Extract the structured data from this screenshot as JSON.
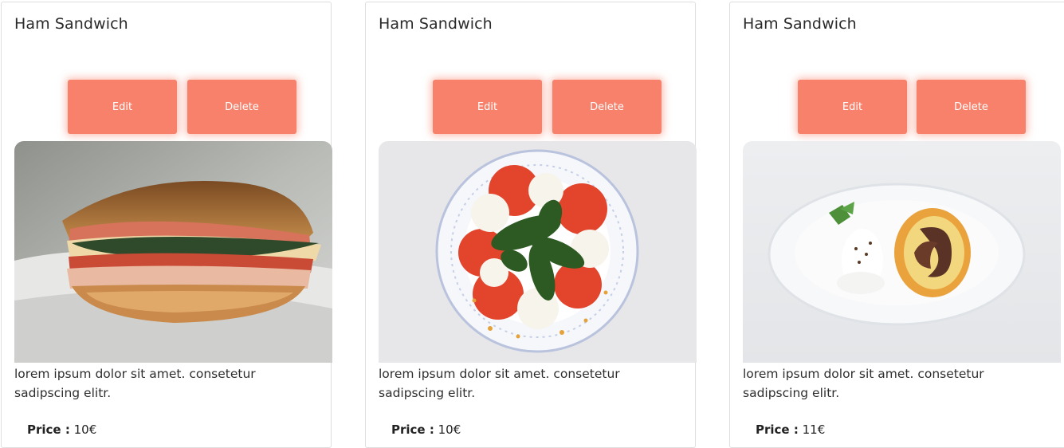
{
  "cards": [
    {
      "title": "Ham Sandwich",
      "edit_label": "Edit",
      "delete_label": "Delete",
      "image": "ham-sandwich",
      "description": "lorem ipsum dolor sit amet. consetetur sadipscing elitr.",
      "price_label": "Price :",
      "price_value": "10€"
    },
    {
      "title": "Ham Sandwich",
      "edit_label": "Edit",
      "delete_label": "Delete",
      "image": "caprese-salad",
      "description": "lorem ipsum dolor sit amet. consetetur sadipscing elitr.",
      "price_label": "Price :",
      "price_value": "10€"
    },
    {
      "title": "Ham Sandwich",
      "edit_label": "Edit",
      "delete_label": "Delete",
      "image": "swiss-roll-cake",
      "description": "lorem ipsum dolor sit amet. consetetur sadipscing elitr.",
      "price_label": "Price :",
      "price_value": "11€"
    }
  ],
  "colors": {
    "button": "#f7816a",
    "button_text": "#ffffff",
    "card_border": "#dedede"
  }
}
